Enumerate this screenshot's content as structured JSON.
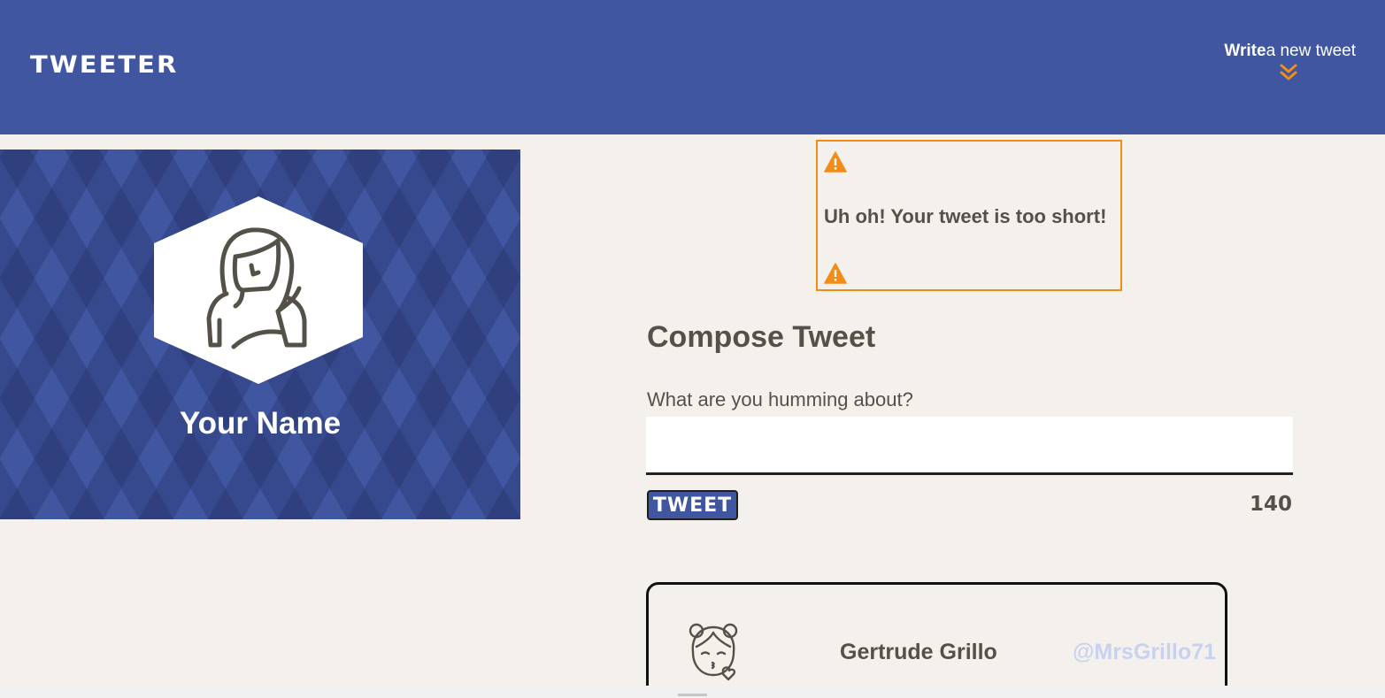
{
  "nav": {
    "brand": "TWEETER",
    "toggle_bold": "Write",
    "toggle_rest": "a new tweet",
    "toggle_icon": "double-chevron-down-icon",
    "bg_color": "#4056a1",
    "accent_color": "#f28c18"
  },
  "profile": {
    "name": "Your Name",
    "avatar_icon": "woman-avatar-icon"
  },
  "error": {
    "message": "Uh oh! Your tweet is too short!",
    "icon": "warning-icon",
    "border_color": "#f28c18"
  },
  "compose": {
    "title": "Compose Tweet",
    "label": "What are you humming about?",
    "input_value": "",
    "button_label": "TWEET",
    "counter": "140"
  },
  "tweets": [
    {
      "name": "Gertrude Grillo",
      "handle": "@MrsGrillo71",
      "avatar_icon": "kissing-girl-avatar-icon"
    }
  ]
}
